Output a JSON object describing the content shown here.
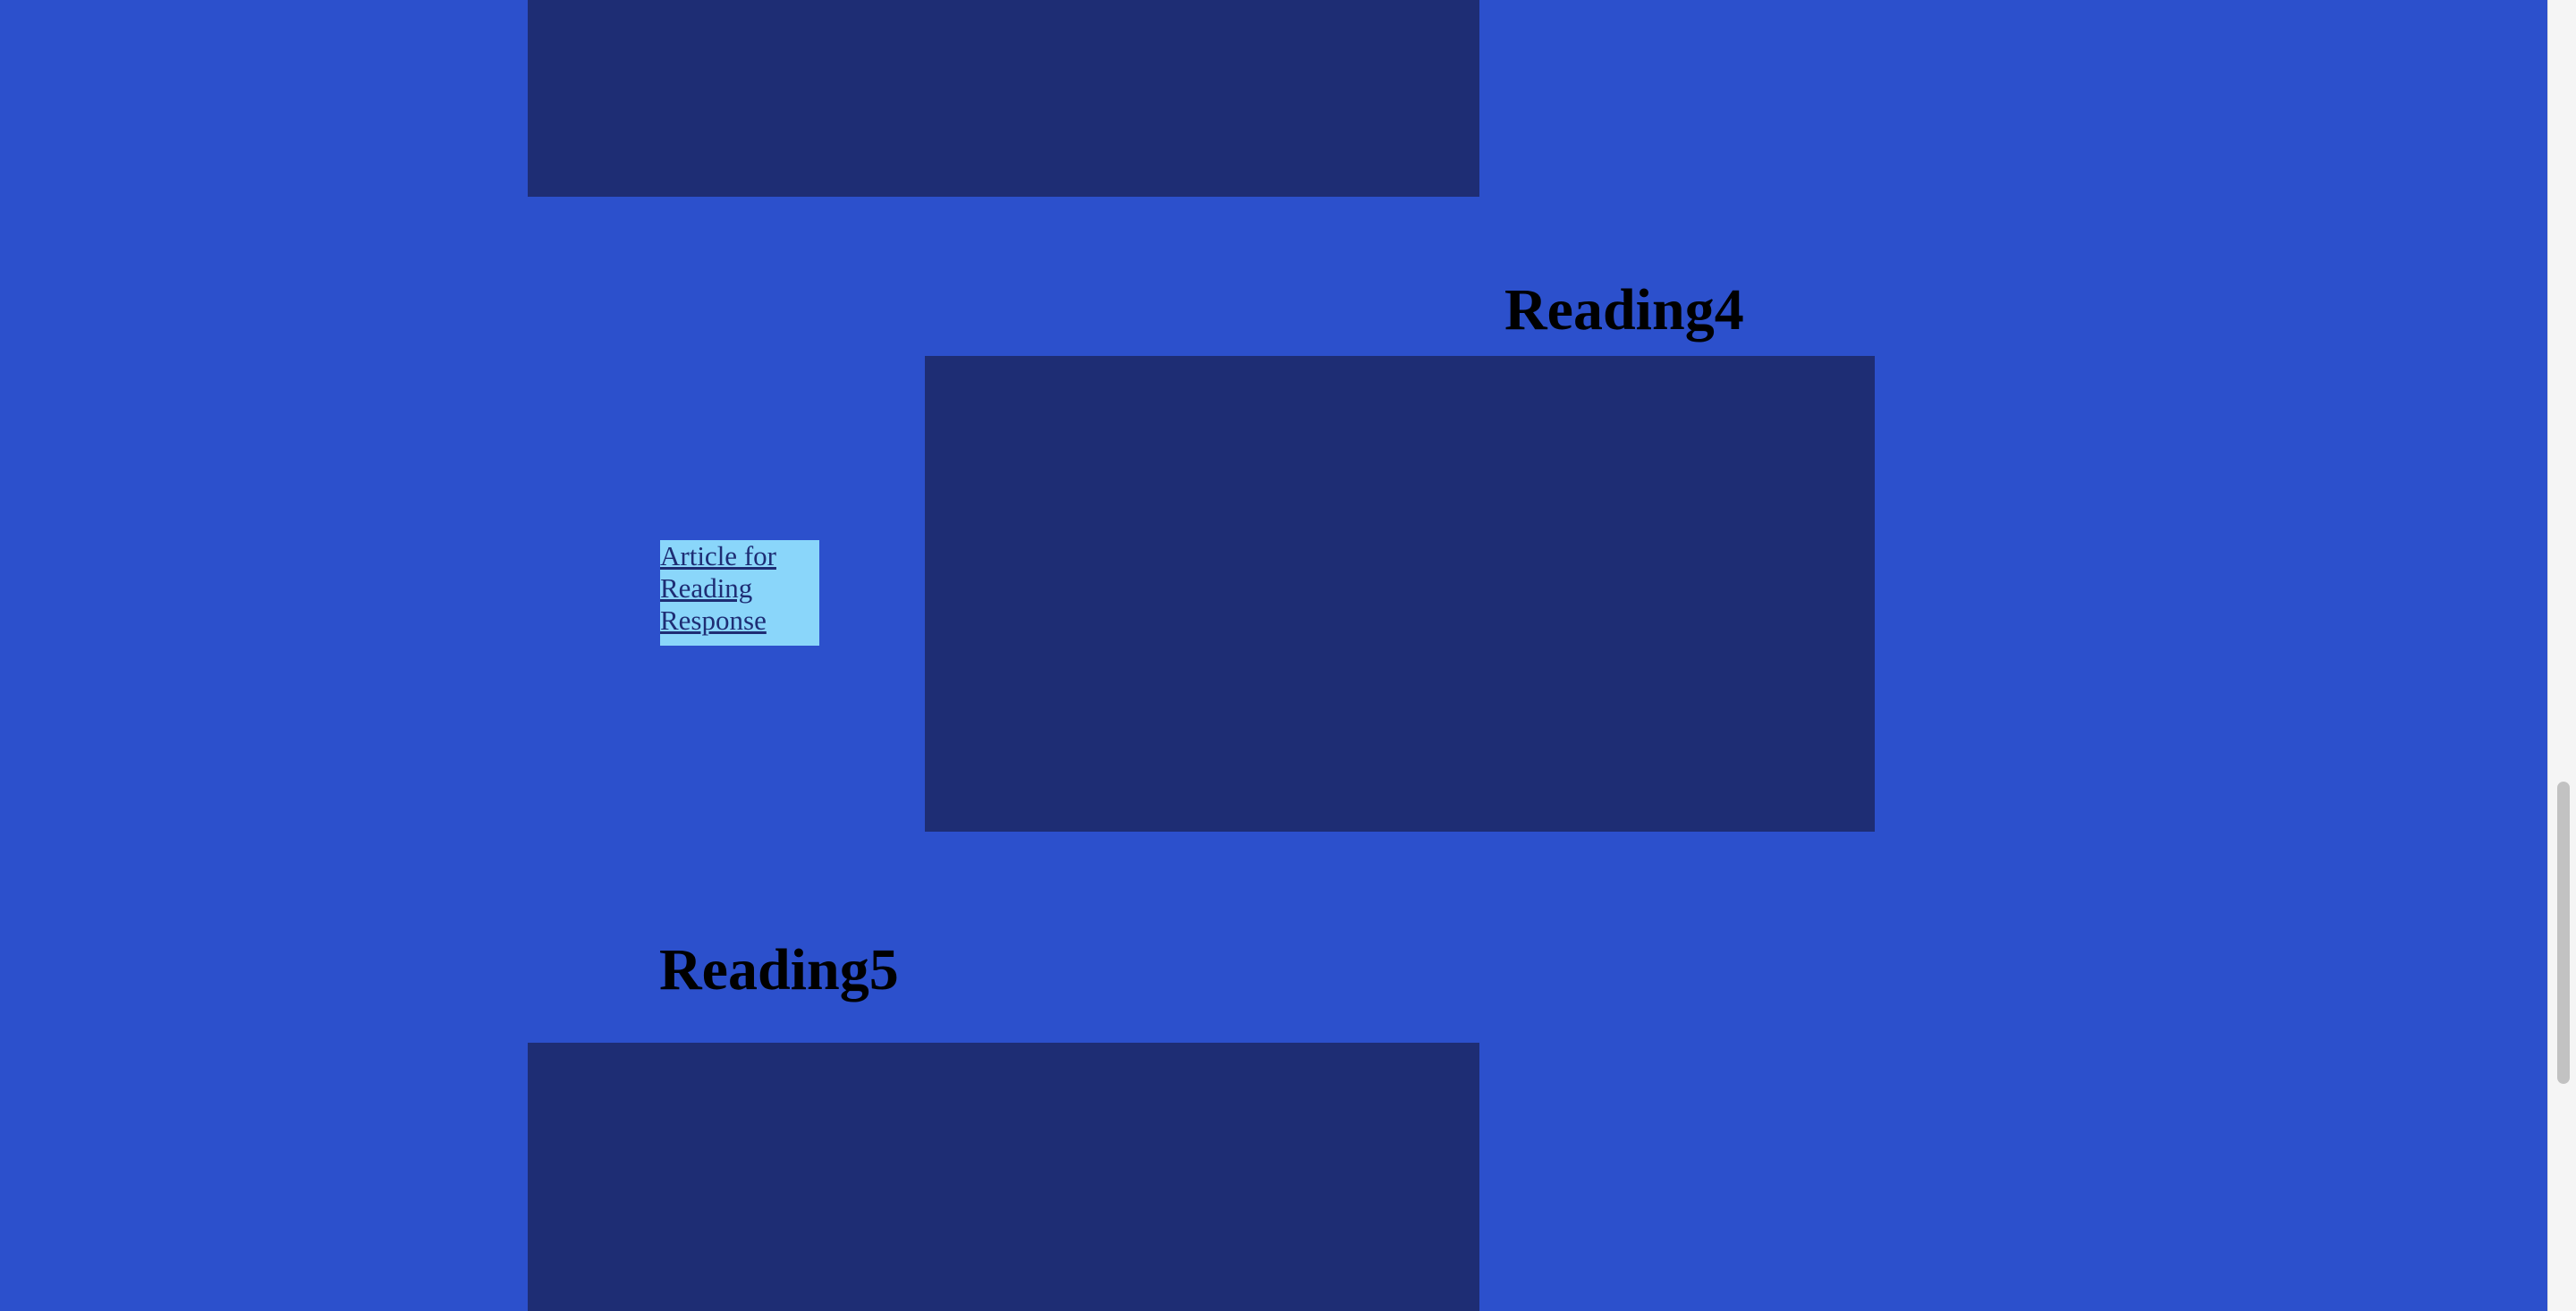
{
  "sections": {
    "reading4": {
      "heading": "Reading4"
    },
    "reading5": {
      "heading": "Reading5"
    }
  },
  "links": {
    "article": {
      "label": "Article for Reading Response"
    }
  },
  "colors": {
    "page_background": "#2c50cc",
    "panel": "#1e2d74",
    "link_box": "#8ad6fa",
    "heading_text": "#000000"
  }
}
